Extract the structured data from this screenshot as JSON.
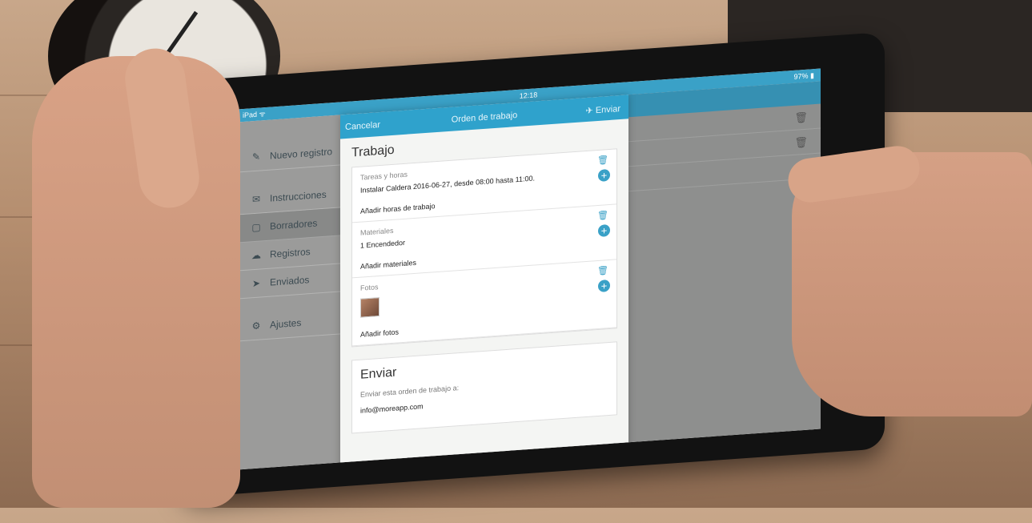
{
  "statusbar": {
    "carrier": "iPad ᯤ",
    "time": "12:18",
    "battery": "97% ▮"
  },
  "sidebar": {
    "items": [
      {
        "label": "Nuevo registro",
        "icon": "edit-icon",
        "glyph": "✎"
      },
      {
        "label": "Instrucciones",
        "icon": "inbox-icon",
        "glyph": "✉"
      },
      {
        "label": "Borradores",
        "icon": "document-icon",
        "glyph": "▢"
      },
      {
        "label": "Registros",
        "icon": "cloud-icon",
        "glyph": "☁"
      },
      {
        "label": "Enviados",
        "icon": "send-icon",
        "glyph": "➤"
      },
      {
        "label": "Ajustes",
        "icon": "settings-icon",
        "glyph": "⚙"
      }
    ]
  },
  "modal": {
    "cancel": "Cancelar",
    "title": "Orden de trabajo",
    "send": "✈ Enviar",
    "section_title": "Trabajo",
    "tasks": {
      "label": "Tareas y horas",
      "value": "Instalar Caldera 2016-06-27, desde 08:00 hasta 11:00.",
      "add": "Añadir horas de trabajo"
    },
    "materials": {
      "label": "Materiales",
      "value": "1 Encendedor",
      "add": "Añadir materiales"
    },
    "photos": {
      "label": "Fotos",
      "add": "Añadir fotos"
    },
    "send_section": {
      "title": "Enviar",
      "subtitle": "Enviar esta orden de trabajo a:",
      "email": "info@moreapp.com"
    }
  }
}
